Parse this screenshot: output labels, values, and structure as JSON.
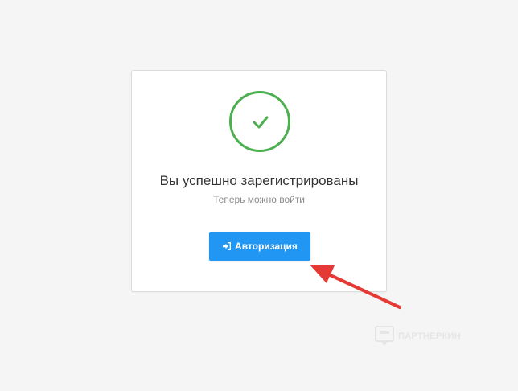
{
  "card": {
    "title": "Вы успешно зарегистрированы",
    "subtitle": "Теперь можно войти",
    "success_icon": "check-circle-icon",
    "button": {
      "label": "Авторизация",
      "icon": "sign-in-icon",
      "color": "#2196f3"
    }
  },
  "annotation": {
    "arrow_color": "#e53935",
    "arrow_icon": "pointer-arrow"
  },
  "watermark": {
    "text": "ПАРТНЕРКИН",
    "icon": "partnerkin-logo-icon"
  },
  "colors": {
    "background": "#f5f5f5",
    "success": "#4caf50",
    "accent": "#2196f3"
  }
}
